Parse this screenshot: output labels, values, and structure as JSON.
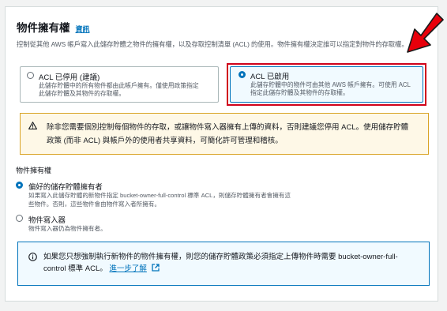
{
  "header": {
    "title": "物件擁有權",
    "info_link": "資訊",
    "description": "控制從其他 AWS 帳戶寫入此儲存貯體之物件的擁有權，以及存取控制清單 (ACL) 的使用。物件擁有權決定誰可以指定對物件的存取權。"
  },
  "acl_options": [
    {
      "title": "ACL 已停用 (建議)",
      "description_lines": [
        "此儲存貯體中的所有物件都由此帳戶擁有。僅使用政策指定",
        "此儲存貯體及其物件的存取權。"
      ],
      "selected": false
    },
    {
      "title": "ACL 已啟用",
      "description_lines": [
        "此儲存貯體中的物件可由其他 AWS 帳戶擁有。可使用 ACL",
        "指定此儲存貯體及其物件的存取權。"
      ],
      "selected": true
    }
  ],
  "warning": {
    "lines": [
      "除非您需要個別控制每個物件的存取，或讓物件寫入器擁有上傳的資料，否則建議您停用 ACL。使用儲存貯體",
      "政策 (而非 ACL) 與帳戶外的使用者共享資料，可簡化許可管理和稽核。"
    ]
  },
  "ownership": {
    "label": "物件擁有權",
    "options": [
      {
        "title": "偏好的儲存貯體擁有者",
        "description_lines": [
          "如果寫入此儲存貯體的新物件指定 bucket-owner-full-control 標準 ACL，則儲存貯體擁有者會擁有這",
          "些物件。否則，這些物件會由物件寫入者所擁有。"
        ],
        "selected": true
      },
      {
        "title": "物件寫入器",
        "description_lines": [
          "物件寫入器仍為物件擁有者。"
        ],
        "selected": false
      }
    ]
  },
  "info_alert": {
    "line1": "如果您只想強制執行新物件的物件擁有權，則您的儲存貯體政策必須指定上傳物件時需要 bucket-owner-full-",
    "line2_prefix": "control 標準 ACL。",
    "learn_more": "進一步了解"
  },
  "colors": {
    "accent": "#0073bb",
    "highlight": "#d0021b",
    "warning_border": "#d9a426",
    "warning_bg": "#fef8e7",
    "info_bg": "#f1faff"
  },
  "icons": {
    "warning": "warning-icon",
    "info": "info-icon",
    "external": "external-link-icon",
    "annotation": "red-arrow-annotation"
  }
}
